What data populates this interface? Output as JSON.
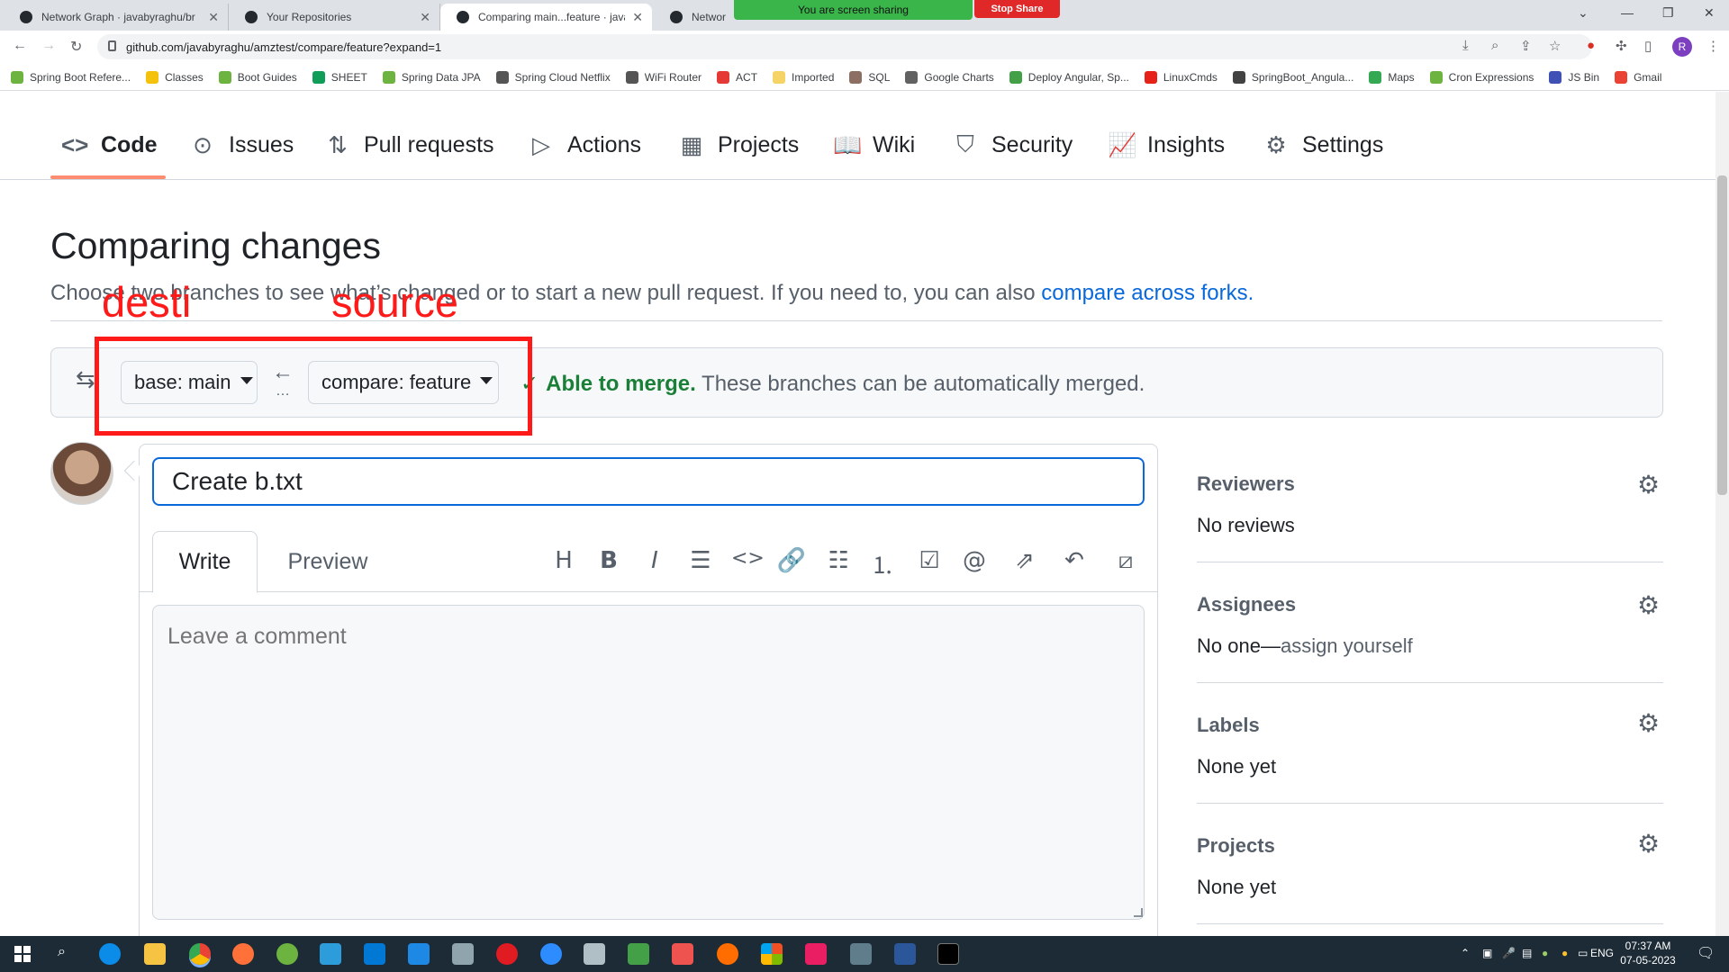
{
  "browser": {
    "tabs": [
      {
        "title": "Network Graph · javabyraghu/br",
        "active": false
      },
      {
        "title": "Your Repositories",
        "active": false
      },
      {
        "title": "Comparing main...feature · javab",
        "active": true
      },
      {
        "title": "Network G",
        "active": false
      }
    ],
    "share_banner": "You are screen sharing",
    "stop_share": "Stop Share",
    "url": "github.com/javabyraghu/amztest/compare/feature?expand=1",
    "profile_initial": "R",
    "bookmarks": [
      {
        "label": "Spring Boot Refere...",
        "color": "#6db33f"
      },
      {
        "label": "Classes",
        "color": "#f4c20d"
      },
      {
        "label": "Boot Guides",
        "color": "#6db33f"
      },
      {
        "label": "SHEET",
        "color": "#0f9d58"
      },
      {
        "label": "Spring Data JPA",
        "color": "#6db33f"
      },
      {
        "label": "Spring Cloud Netflix",
        "color": "#555555"
      },
      {
        "label": "WiFi Router",
        "color": "#555555"
      },
      {
        "label": "ACT",
        "color": "#e53935"
      },
      {
        "label": "Imported",
        "color": "#f6d365"
      },
      {
        "label": "SQL",
        "color": "#8d6e63"
      },
      {
        "label": "Google Charts",
        "color": "#616161"
      },
      {
        "label": "Deploy Angular, Sp...",
        "color": "#43a047"
      },
      {
        "label": "LinuxCmds",
        "color": "#e62117"
      },
      {
        "label": "SpringBoot_Angula...",
        "color": "#424242"
      },
      {
        "label": "Maps",
        "color": "#34a853"
      },
      {
        "label": "Cron Expressions",
        "color": "#6db33f"
      },
      {
        "label": "JS Bin",
        "color": "#3f51b5"
      },
      {
        "label": "Gmail",
        "color": "#ea4335"
      }
    ]
  },
  "repo_nav": {
    "tabs": [
      {
        "label": "Code",
        "icon": "code-icon",
        "glyph": "<>"
      },
      {
        "label": "Issues",
        "icon": "issue-icon",
        "glyph": "⊙"
      },
      {
        "label": "Pull requests",
        "icon": "pull-request-icon",
        "glyph": "⇅"
      },
      {
        "label": "Actions",
        "icon": "play-icon",
        "glyph": "▷"
      },
      {
        "label": "Projects",
        "icon": "table-icon",
        "glyph": "▦"
      },
      {
        "label": "Wiki",
        "icon": "book-icon",
        "glyph": "📖"
      },
      {
        "label": "Security",
        "icon": "shield-icon",
        "glyph": "⛉"
      },
      {
        "label": "Insights",
        "icon": "graph-icon",
        "glyph": "📈"
      },
      {
        "label": "Settings",
        "icon": "gear-icon",
        "glyph": "⚙"
      }
    ]
  },
  "compare": {
    "title": "Comparing changes",
    "subtitle": "Choose two branches to see what’s changed or to start a new pull request. If you need to, you can also",
    "subtitle_link": "compare across forks.",
    "base_label": "base:",
    "base_branch": "main",
    "compare_label": "compare:",
    "compare_branch": "feature",
    "merge_status": "Able to merge.",
    "merge_detail": "These branches can be automatically merged."
  },
  "annotations": {
    "left": "desti",
    "right": "source"
  },
  "pr_form": {
    "title_value": "Create b.txt",
    "tab_write": "Write",
    "tab_preview": "Preview",
    "comment_placeholder": "Leave a comment",
    "toolbar_icons": [
      "heading-icon",
      "bold-icon",
      "italic-icon",
      "quote-icon",
      "code-icon",
      "link-icon",
      "bulleted-list-icon",
      "numbered-list-icon",
      "task-list-icon",
      "mention-icon",
      "reference-icon",
      "reply-icon",
      "slash-commands-icon"
    ]
  },
  "sidebar": {
    "reviewers_title": "Reviewers",
    "reviewers_value": "No reviews",
    "assignees_title": "Assignees",
    "assignees_value": "No one—",
    "assignees_link": "assign yourself",
    "labels_title": "Labels",
    "labels_value": "None yet",
    "projects_title": "Projects",
    "projects_value": "None yet"
  },
  "taskbar": {
    "language": "ENG",
    "time": "07:37 AM",
    "date": "07-05-2023"
  },
  "colors": {
    "accent": "#0969da",
    "success": "#1a7f37",
    "annotation": "#ff1a1a",
    "tab_underline": "#fd8c73"
  }
}
